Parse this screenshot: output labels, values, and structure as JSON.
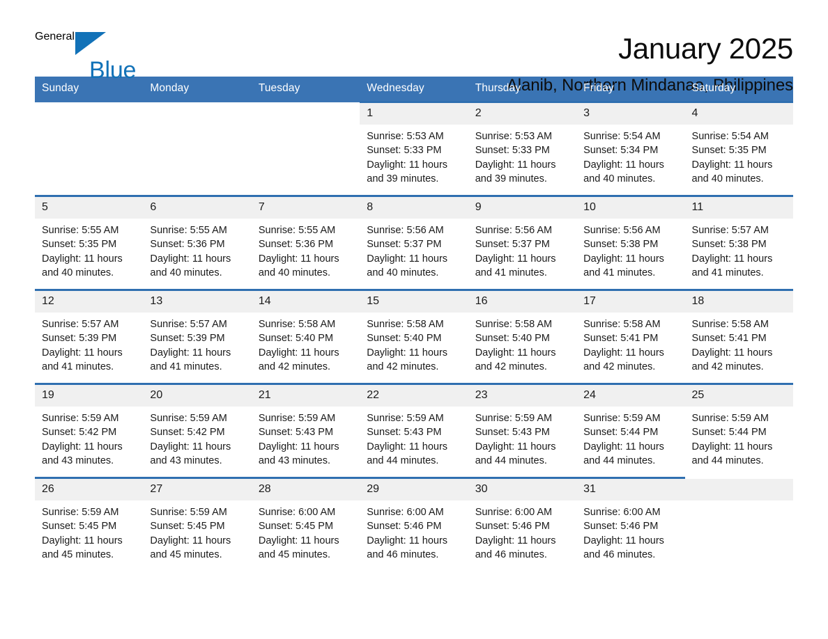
{
  "brand": {
    "name_part1": "General",
    "name_part2": "Blue",
    "triangle_icon": "triangle-icon",
    "accent_color": "#1272b8"
  },
  "header": {
    "month_title": "January 2025",
    "location": "Alanib, Northern Mindanao, Philippines"
  },
  "calendar": {
    "header_bg": "#3a74b4",
    "row_border_color": "#2f6fb0",
    "daynum_bg": "#f0f0f0",
    "weekday_headers": [
      "Sunday",
      "Monday",
      "Tuesday",
      "Wednesday",
      "Thursday",
      "Friday",
      "Saturday"
    ],
    "weeks": [
      [
        {
          "day": "",
          "sunrise": "",
          "sunset": "",
          "daylight": "",
          "daylight2": "",
          "empty": true
        },
        {
          "day": "",
          "sunrise": "",
          "sunset": "",
          "daylight": "",
          "daylight2": "",
          "empty": true
        },
        {
          "day": "",
          "sunrise": "",
          "sunset": "",
          "daylight": "",
          "daylight2": "",
          "empty": true
        },
        {
          "day": "1",
          "sunrise": "Sunrise: 5:53 AM",
          "sunset": "Sunset: 5:33 PM",
          "daylight": "Daylight: 11 hours",
          "daylight2": "and 39 minutes.",
          "empty": false
        },
        {
          "day": "2",
          "sunrise": "Sunrise: 5:53 AM",
          "sunset": "Sunset: 5:33 PM",
          "daylight": "Daylight: 11 hours",
          "daylight2": "and 39 minutes.",
          "empty": false
        },
        {
          "day": "3",
          "sunrise": "Sunrise: 5:54 AM",
          "sunset": "Sunset: 5:34 PM",
          "daylight": "Daylight: 11 hours",
          "daylight2": "and 40 minutes.",
          "empty": false
        },
        {
          "day": "4",
          "sunrise": "Sunrise: 5:54 AM",
          "sunset": "Sunset: 5:35 PM",
          "daylight": "Daylight: 11 hours",
          "daylight2": "and 40 minutes.",
          "empty": false
        }
      ],
      [
        {
          "day": "5",
          "sunrise": "Sunrise: 5:55 AM",
          "sunset": "Sunset: 5:35 PM",
          "daylight": "Daylight: 11 hours",
          "daylight2": "and 40 minutes.",
          "empty": false
        },
        {
          "day": "6",
          "sunrise": "Sunrise: 5:55 AM",
          "sunset": "Sunset: 5:36 PM",
          "daylight": "Daylight: 11 hours",
          "daylight2": "and 40 minutes.",
          "empty": false
        },
        {
          "day": "7",
          "sunrise": "Sunrise: 5:55 AM",
          "sunset": "Sunset: 5:36 PM",
          "daylight": "Daylight: 11 hours",
          "daylight2": "and 40 minutes.",
          "empty": false
        },
        {
          "day": "8",
          "sunrise": "Sunrise: 5:56 AM",
          "sunset": "Sunset: 5:37 PM",
          "daylight": "Daylight: 11 hours",
          "daylight2": "and 40 minutes.",
          "empty": false
        },
        {
          "day": "9",
          "sunrise": "Sunrise: 5:56 AM",
          "sunset": "Sunset: 5:37 PM",
          "daylight": "Daylight: 11 hours",
          "daylight2": "and 41 minutes.",
          "empty": false
        },
        {
          "day": "10",
          "sunrise": "Sunrise: 5:56 AM",
          "sunset": "Sunset: 5:38 PM",
          "daylight": "Daylight: 11 hours",
          "daylight2": "and 41 minutes.",
          "empty": false
        },
        {
          "day": "11",
          "sunrise": "Sunrise: 5:57 AM",
          "sunset": "Sunset: 5:38 PM",
          "daylight": "Daylight: 11 hours",
          "daylight2": "and 41 minutes.",
          "empty": false
        }
      ],
      [
        {
          "day": "12",
          "sunrise": "Sunrise: 5:57 AM",
          "sunset": "Sunset: 5:39 PM",
          "daylight": "Daylight: 11 hours",
          "daylight2": "and 41 minutes.",
          "empty": false
        },
        {
          "day": "13",
          "sunrise": "Sunrise: 5:57 AM",
          "sunset": "Sunset: 5:39 PM",
          "daylight": "Daylight: 11 hours",
          "daylight2": "and 41 minutes.",
          "empty": false
        },
        {
          "day": "14",
          "sunrise": "Sunrise: 5:58 AM",
          "sunset": "Sunset: 5:40 PM",
          "daylight": "Daylight: 11 hours",
          "daylight2": "and 42 minutes.",
          "empty": false
        },
        {
          "day": "15",
          "sunrise": "Sunrise: 5:58 AM",
          "sunset": "Sunset: 5:40 PM",
          "daylight": "Daylight: 11 hours",
          "daylight2": "and 42 minutes.",
          "empty": false
        },
        {
          "day": "16",
          "sunrise": "Sunrise: 5:58 AM",
          "sunset": "Sunset: 5:40 PM",
          "daylight": "Daylight: 11 hours",
          "daylight2": "and 42 minutes.",
          "empty": false
        },
        {
          "day": "17",
          "sunrise": "Sunrise: 5:58 AM",
          "sunset": "Sunset: 5:41 PM",
          "daylight": "Daylight: 11 hours",
          "daylight2": "and 42 minutes.",
          "empty": false
        },
        {
          "day": "18",
          "sunrise": "Sunrise: 5:58 AM",
          "sunset": "Sunset: 5:41 PM",
          "daylight": "Daylight: 11 hours",
          "daylight2": "and 42 minutes.",
          "empty": false
        }
      ],
      [
        {
          "day": "19",
          "sunrise": "Sunrise: 5:59 AM",
          "sunset": "Sunset: 5:42 PM",
          "daylight": "Daylight: 11 hours",
          "daylight2": "and 43 minutes.",
          "empty": false
        },
        {
          "day": "20",
          "sunrise": "Sunrise: 5:59 AM",
          "sunset": "Sunset: 5:42 PM",
          "daylight": "Daylight: 11 hours",
          "daylight2": "and 43 minutes.",
          "empty": false
        },
        {
          "day": "21",
          "sunrise": "Sunrise: 5:59 AM",
          "sunset": "Sunset: 5:43 PM",
          "daylight": "Daylight: 11 hours",
          "daylight2": "and 43 minutes.",
          "empty": false
        },
        {
          "day": "22",
          "sunrise": "Sunrise: 5:59 AM",
          "sunset": "Sunset: 5:43 PM",
          "daylight": "Daylight: 11 hours",
          "daylight2": "and 44 minutes.",
          "empty": false
        },
        {
          "day": "23",
          "sunrise": "Sunrise: 5:59 AM",
          "sunset": "Sunset: 5:43 PM",
          "daylight": "Daylight: 11 hours",
          "daylight2": "and 44 minutes.",
          "empty": false
        },
        {
          "day": "24",
          "sunrise": "Sunrise: 5:59 AM",
          "sunset": "Sunset: 5:44 PM",
          "daylight": "Daylight: 11 hours",
          "daylight2": "and 44 minutes.",
          "empty": false
        },
        {
          "day": "25",
          "sunrise": "Sunrise: 5:59 AM",
          "sunset": "Sunset: 5:44 PM",
          "daylight": "Daylight: 11 hours",
          "daylight2": "and 44 minutes.",
          "empty": false
        }
      ],
      [
        {
          "day": "26",
          "sunrise": "Sunrise: 5:59 AM",
          "sunset": "Sunset: 5:45 PM",
          "daylight": "Daylight: 11 hours",
          "daylight2": "and 45 minutes.",
          "empty": false
        },
        {
          "day": "27",
          "sunrise": "Sunrise: 5:59 AM",
          "sunset": "Sunset: 5:45 PM",
          "daylight": "Daylight: 11 hours",
          "daylight2": "and 45 minutes.",
          "empty": false
        },
        {
          "day": "28",
          "sunrise": "Sunrise: 6:00 AM",
          "sunset": "Sunset: 5:45 PM",
          "daylight": "Daylight: 11 hours",
          "daylight2": "and 45 minutes.",
          "empty": false
        },
        {
          "day": "29",
          "sunrise": "Sunrise: 6:00 AM",
          "sunset": "Sunset: 5:46 PM",
          "daylight": "Daylight: 11 hours",
          "daylight2": "and 46 minutes.",
          "empty": false
        },
        {
          "day": "30",
          "sunrise": "Sunrise: 6:00 AM",
          "sunset": "Sunset: 5:46 PM",
          "daylight": "Daylight: 11 hours",
          "daylight2": "and 46 minutes.",
          "empty": false
        },
        {
          "day": "31",
          "sunrise": "Sunrise: 6:00 AM",
          "sunset": "Sunset: 5:46 PM",
          "daylight": "Daylight: 11 hours",
          "daylight2": "and 46 minutes.",
          "empty": false
        },
        {
          "day": "",
          "sunrise": "",
          "sunset": "",
          "daylight": "",
          "daylight2": "",
          "empty": true,
          "shaded": true
        }
      ]
    ]
  }
}
